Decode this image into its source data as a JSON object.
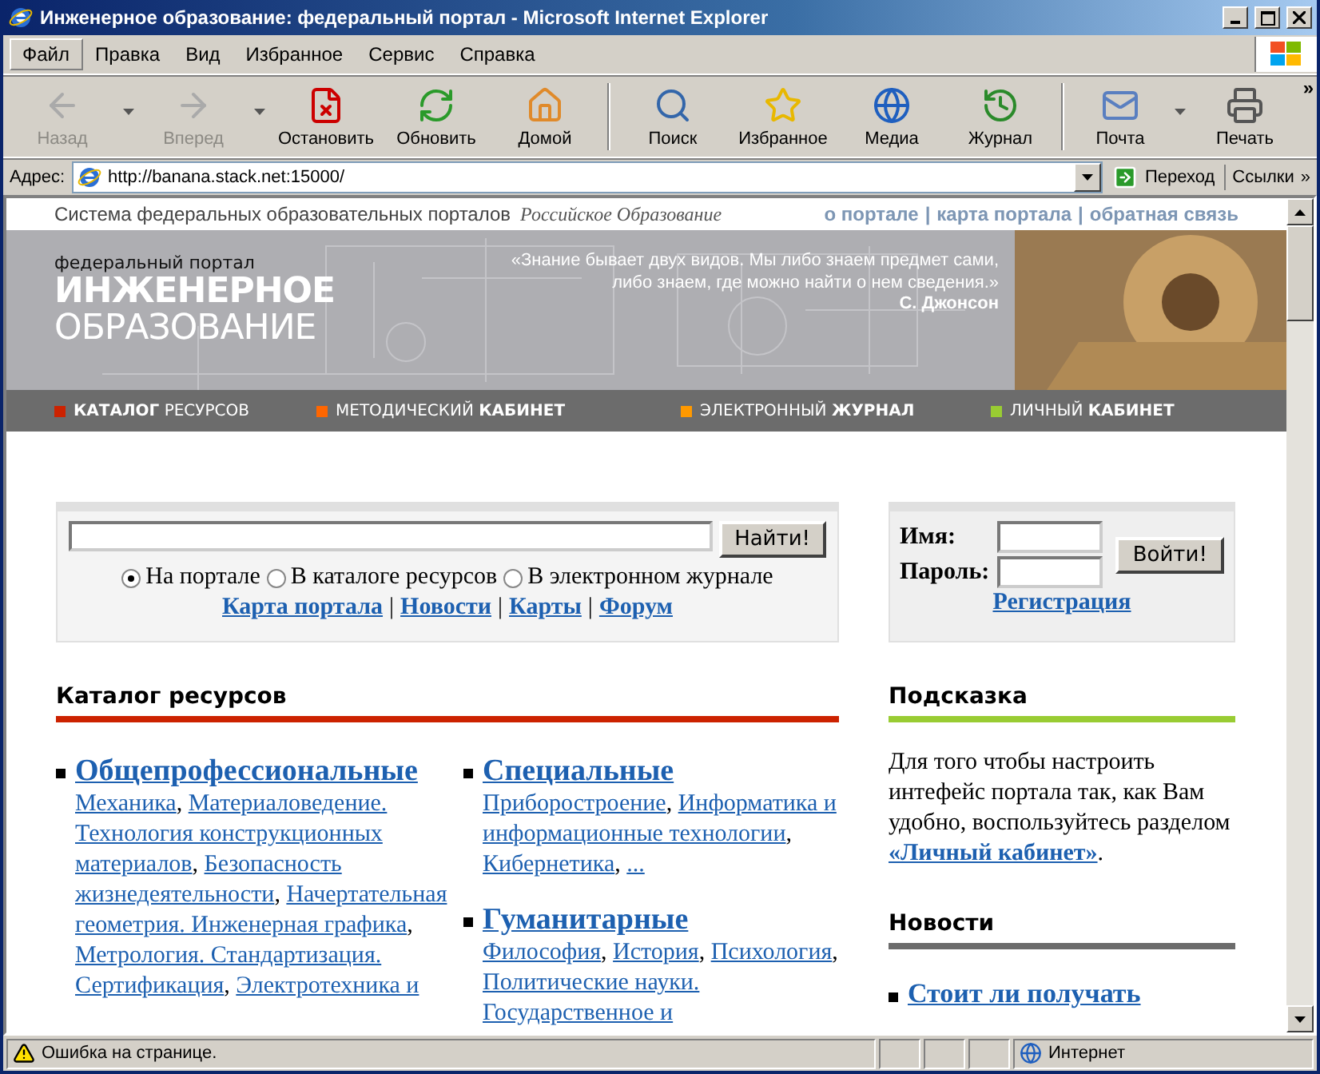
{
  "window": {
    "title": "Инженерное образование: федеральный портал - Microsoft Internet Explorer"
  },
  "menu": [
    {
      "label": "Файл",
      "selected": true
    },
    {
      "label": "Правка",
      "selected": false
    },
    {
      "label": "Вид",
      "selected": false
    },
    {
      "label": "Избранное",
      "selected": false
    },
    {
      "label": "Сервис",
      "selected": false
    },
    {
      "label": "Справка",
      "selected": false
    }
  ],
  "toolbar": [
    {
      "label": "Назад",
      "disabled": true
    },
    {
      "label": "Вперед",
      "disabled": true
    },
    {
      "label": "Остановить",
      "disabled": false
    },
    {
      "label": "Обновить",
      "disabled": false
    },
    {
      "label": "Домой",
      "disabled": false
    },
    {
      "label": "Поиск",
      "disabled": false
    },
    {
      "label": "Избранное",
      "disabled": false
    },
    {
      "label": "Медиа",
      "disabled": false
    },
    {
      "label": "Журнал",
      "disabled": false
    },
    {
      "label": "Почта",
      "disabled": false
    },
    {
      "label": "Печать",
      "disabled": false
    }
  ],
  "toolbar_more": "»",
  "address_bar": {
    "label": "Адрес:",
    "url": "http://banana.stack.net:15000/",
    "go": "Переход",
    "links": "Ссылки",
    "more": "»"
  },
  "portal": {
    "system_text": "Система федеральных образовательных порталов",
    "system_logo": "Российское Образование",
    "top_links": [
      "о портале",
      "карта портала",
      "обратная связь"
    ],
    "top_separator": "|",
    "logo": {
      "kicker": "федеральный портал",
      "line_1": "ИНЖЕНЕРНОЕ",
      "line_2": "ОБРАЗОВАНИЕ"
    },
    "quote": {
      "lines": [
        "«Знание бывает двух видов. Мы либо знаем предмет сами,",
        "либо знаем, где можно найти о нем сведения.»"
      ],
      "author": "С. Джонсон"
    },
    "nav": [
      {
        "label": "**КАТАЛОГ** РЕСУРСОВ",
        "color": "#cc2200"
      },
      {
        "label": "МЕТОДИЧЕСКИЙ **КАБИНЕТ**",
        "color": "#ff6600"
      },
      {
        "label": "ЭЛЕКТРОННЫЙ **ЖУРНАЛ**",
        "color": "#ff9900"
      },
      {
        "label": "ЛИЧНЫЙ **КАБИНЕТ**",
        "color": "#99cc33"
      }
    ]
  },
  "search": {
    "button": "Найти!",
    "scopes": [
      {
        "label": "На портале",
        "selected": true
      },
      {
        "label": "В каталоге ресурсов",
        "selected": false
      },
      {
        "label": "В электронном журнале",
        "selected": false
      }
    ],
    "links": [
      "Карта портала",
      "Новости",
      "Карты",
      "Форум"
    ],
    "separator": "|"
  },
  "login": {
    "name_label": "Имя:",
    "password_label": "Пароль:",
    "button": "Войти!",
    "register": "Регистрация"
  },
  "catalog": {
    "title": "Каталог ресурсов",
    "separator": ", ",
    "columns": [
      [
        {
          "title": "Общепрофессиональные",
          "links": [
            "Механика",
            "Материаловедение. Технология конструкционных материалов",
            "Безопасность жизнедеятельности",
            "Начертательная геометрия. Инженерная графика",
            "Метрология. Стандартизация. Сертификация",
            "Электротехника и"
          ]
        }
      ],
      [
        {
          "title": "Специальные",
          "links": [
            "Приборостроение",
            "Информатика и информационные технологии",
            "Кибернетика",
            "..."
          ]
        },
        {
          "title": "Гуманитарные",
          "links": [
            "Философия",
            "История",
            "Психология",
            "Политические науки. Государственное и"
          ]
        }
      ]
    ]
  },
  "hint": {
    "title": "Подсказка",
    "text": "Для того чтобы настроить интефейс портала так, как Вам удобно, воспользуйтесь разделом",
    "link": "«Личный кабинет»",
    "after": "."
  },
  "news": {
    "title": "Новости",
    "items": [
      "Стоит ли получать"
    ]
  },
  "status_bar": {
    "text": "Ошибка на странице.",
    "zone": "Интернет"
  }
}
